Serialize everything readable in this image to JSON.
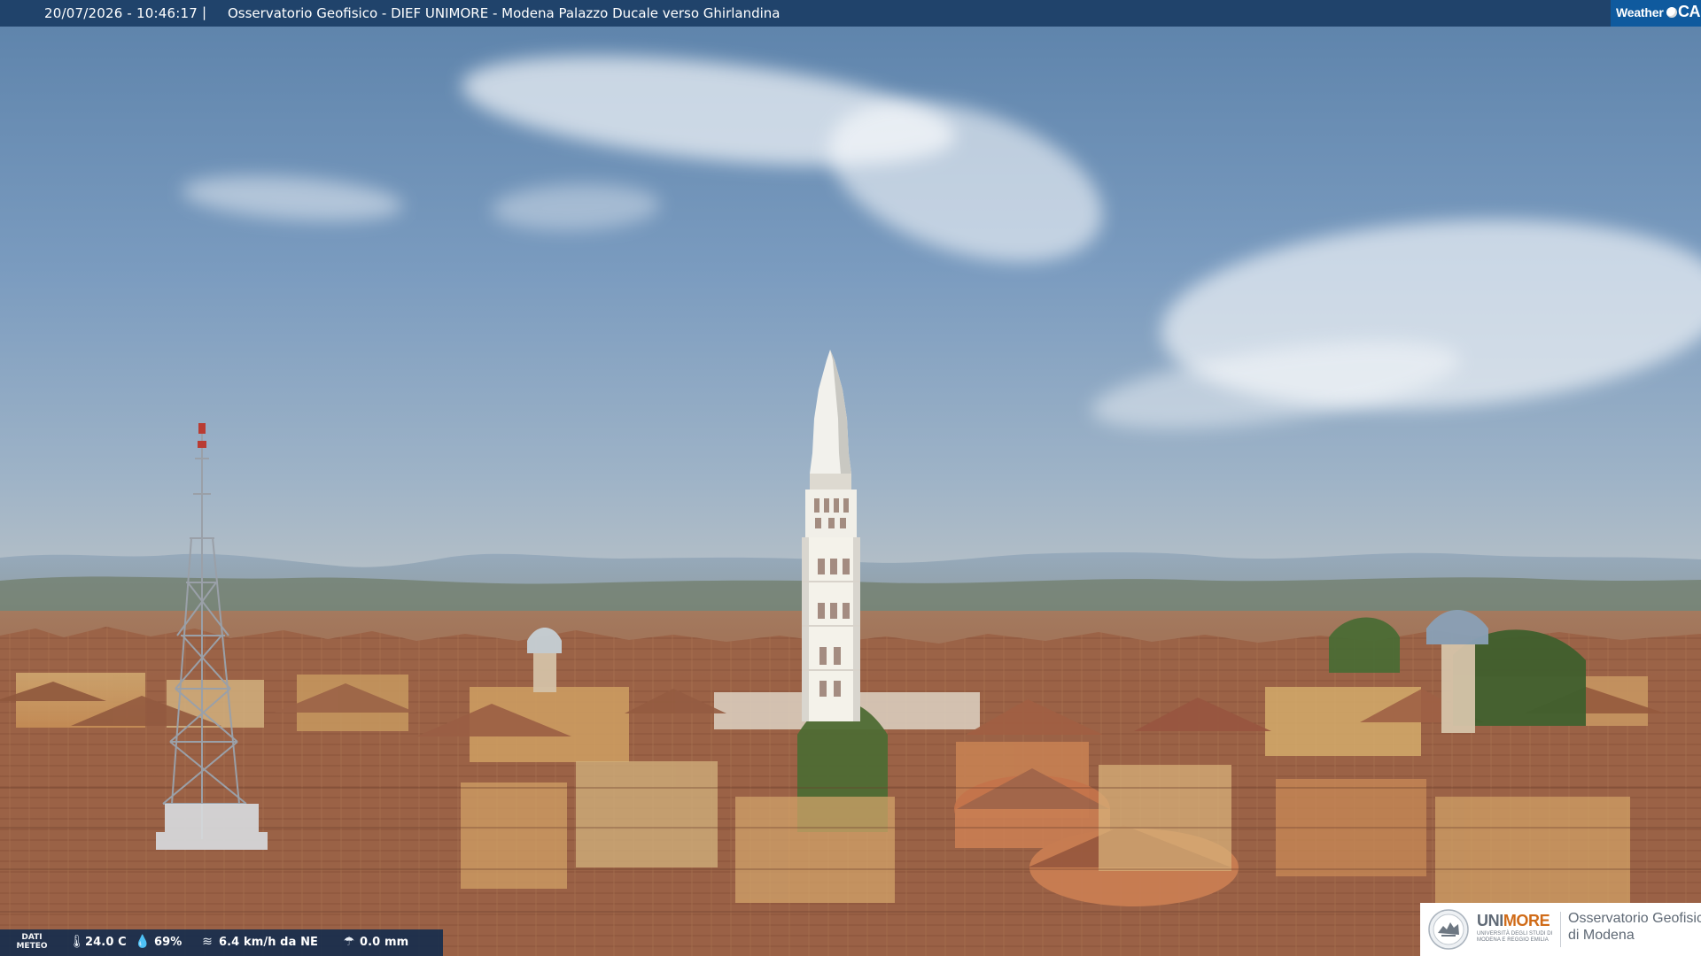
{
  "top_bar": {
    "datetime": "20/07/2026 - 10:46:17",
    "separator": "|",
    "caption": "Osservatorio Geofisico - DIEF UNIMORE - Modena Palazzo Ducale verso Ghirlandina"
  },
  "brand": {
    "weather": "Weather",
    "cam": "CAM"
  },
  "weather": {
    "meteo_label": "DATI METEO",
    "temperature": "24.0 C",
    "humidity": "69%",
    "wind": "6.4 km/h da NE",
    "rain": "0.0 mm"
  },
  "logo": {
    "unimore_prefix": "UNI",
    "unimore_suffix": "MORE",
    "university_line": "UNIVERSITÀ DEGLI STUDI DI MODENA E REGGIO EMILIA",
    "observatory_line_1": "Osservatorio Geofisico",
    "observatory_line_2": "di Modena"
  },
  "icons": {
    "temperature": "thermometer-icon",
    "humidity": "droplet-icon",
    "wind": "wind-icon",
    "rain": "rain-icon",
    "brand": "weather-cam-logo-icon",
    "unimore": "unimore-seal-icon"
  },
  "colors": {
    "sky_top": "#5c82aa",
    "sky_mid": "#9eb3c7",
    "roof_terracotta": "#9b6246",
    "top_bar": "#183a62",
    "brand_blue": "#0f5ca1",
    "logo_orange": "#d06b18"
  }
}
